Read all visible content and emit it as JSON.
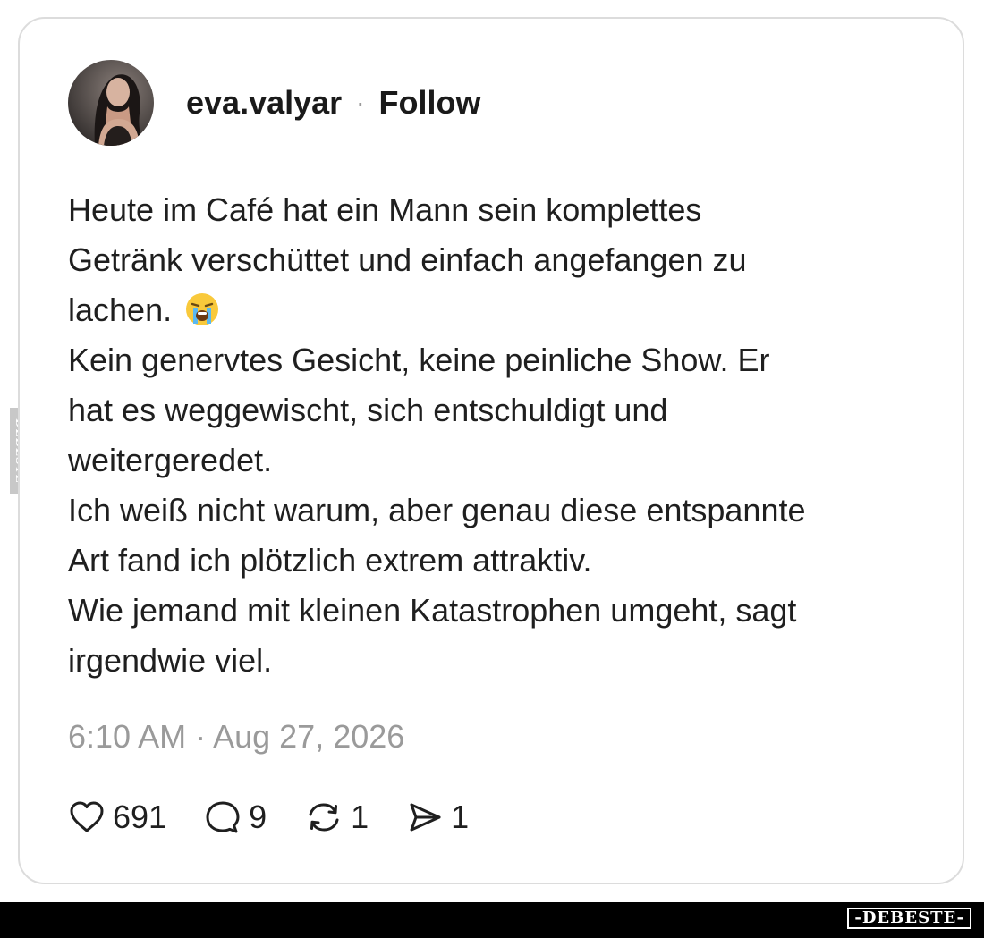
{
  "post": {
    "username": "eva.valyar",
    "separator": "·",
    "follow_label": "Follow",
    "body_lines": [
      "Heute im Café hat ein Mann sein komplettes",
      "Getränk verschüttet und einfach angefangen zu",
      "lachen.",
      "Kein genervtes Gesicht, keine peinliche Show. Er",
      "hat es weggewischt, sich entschuldigt und",
      "weitergeredet.",
      "Ich weiß nicht warum, aber genau diese entspannte",
      "Art fand ich plötzlich extrem attraktiv.",
      "Wie jemand mit kleinen Katastrophen umgeht, sagt",
      "irgendwie viel."
    ],
    "emoji": "loudly-crying-face-emoji",
    "timestamp": "6:10 AM · Aug 27, 2026"
  },
  "actions": {
    "likes": "691",
    "replies": "9",
    "reposts": "1",
    "shares": "1"
  },
  "icons": {
    "like": "heart-icon",
    "reply": "speech-bubble-icon",
    "repost": "repost-icon",
    "share": "paper-plane-icon"
  },
  "watermark": {
    "bottom": "-DEBESTE-",
    "side": "DEBESTE"
  },
  "colors": {
    "text": "#1f1f1f",
    "muted": "#9a9a9a",
    "border": "#dcdcdc",
    "bar": "#000000"
  }
}
